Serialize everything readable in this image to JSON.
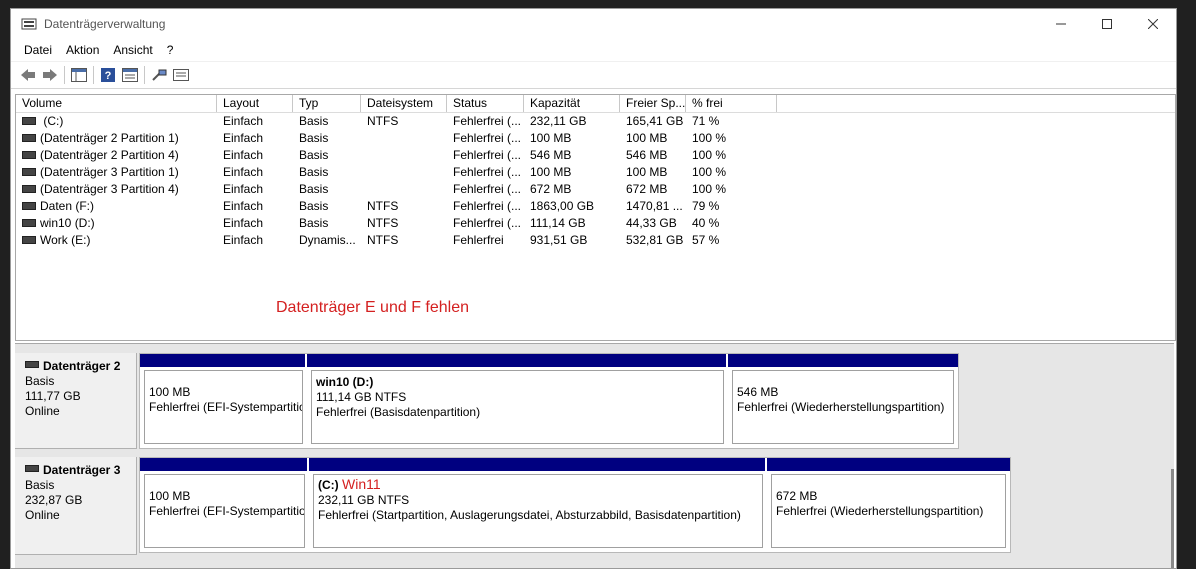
{
  "window": {
    "title": "Datenträgerverwaltung"
  },
  "menu": [
    "Datei",
    "Aktion",
    "Ansicht",
    "?"
  ],
  "columns": [
    "Volume",
    "Layout",
    "Typ",
    "Dateisystem",
    "Status",
    "Kapazität",
    "Freier Sp...",
    "% frei"
  ],
  "volumes": [
    {
      "volume": " (C:)",
      "layout": "Einfach",
      "typ": "Basis",
      "fs": "NTFS",
      "status": "Fehlerfrei (...",
      "cap": "232,11 GB",
      "free": "165,41 GB",
      "pct": "71 %"
    },
    {
      "volume": "(Datenträger 2 Partition 1)",
      "layout": "Einfach",
      "typ": "Basis",
      "fs": "",
      "status": "Fehlerfrei (...",
      "cap": "100 MB",
      "free": "100 MB",
      "pct": "100 %"
    },
    {
      "volume": "(Datenträger 2 Partition 4)",
      "layout": "Einfach",
      "typ": "Basis",
      "fs": "",
      "status": "Fehlerfrei (...",
      "cap": "546 MB",
      "free": "546 MB",
      "pct": "100 %"
    },
    {
      "volume": "(Datenträger 3 Partition 1)",
      "layout": "Einfach",
      "typ": "Basis",
      "fs": "",
      "status": "Fehlerfrei (...",
      "cap": "100 MB",
      "free": "100 MB",
      "pct": "100 %"
    },
    {
      "volume": "(Datenträger 3 Partition 4)",
      "layout": "Einfach",
      "typ": "Basis",
      "fs": "",
      "status": "Fehlerfrei (...",
      "cap": "672 MB",
      "free": "672 MB",
      "pct": "100 %"
    },
    {
      "volume": "Daten (F:)",
      "layout": "Einfach",
      "typ": "Basis",
      "fs": "NTFS",
      "status": "Fehlerfrei (...",
      "cap": "1863,00 GB",
      "free": "1470,81 ...",
      "pct": "79 %"
    },
    {
      "volume": "win10 (D:)",
      "layout": "Einfach",
      "typ": "Basis",
      "fs": "NTFS",
      "status": "Fehlerfrei (...",
      "cap": "111,14 GB",
      "free": "44,33 GB",
      "pct": "40 %"
    },
    {
      "volume": "Work (E:)",
      "layout": "Einfach",
      "typ": "Dynamis...",
      "fs": "NTFS",
      "status": "Fehlerfrei",
      "cap": "931,51 GB",
      "free": "532,81 GB",
      "pct": "57 %"
    }
  ],
  "annotation": "Datenträger E und F fehlen",
  "disks": [
    {
      "name": "Datenträger 2",
      "type": "Basis",
      "size": "111,77 GB",
      "status": "Online",
      "partitions": [
        {
          "name": "",
          "size": "100 MB",
          "desc": "Fehlerfrei (EFI-Systempartition)"
        },
        {
          "name": "win10  (D:)",
          "size": "111,14 GB NTFS",
          "desc": "Fehlerfrei (Basisdatenpartition)"
        },
        {
          "name": "",
          "size": "546 MB",
          "desc": "Fehlerfrei (Wiederherstellungspartition)"
        }
      ]
    },
    {
      "name": "Datenträger 3",
      "type": "Basis",
      "size": "232,87 GB",
      "status": "Online",
      "partitions": [
        {
          "name": "",
          "size": "100 MB",
          "desc": "Fehlerfrei (EFI-Systempartition)"
        },
        {
          "name": "(C:)",
          "extra": "Win11",
          "size": "232,11 GB NTFS",
          "desc": "Fehlerfrei (Startpartition, Auslagerungsdatei, Absturzabbild, Basisdatenpartition)"
        },
        {
          "name": "",
          "size": "672 MB",
          "desc": "Fehlerfrei (Wiederherstellungspartition)"
        }
      ]
    }
  ],
  "colors": {
    "partition_bar": "#000080",
    "annotation": "#d42020"
  }
}
